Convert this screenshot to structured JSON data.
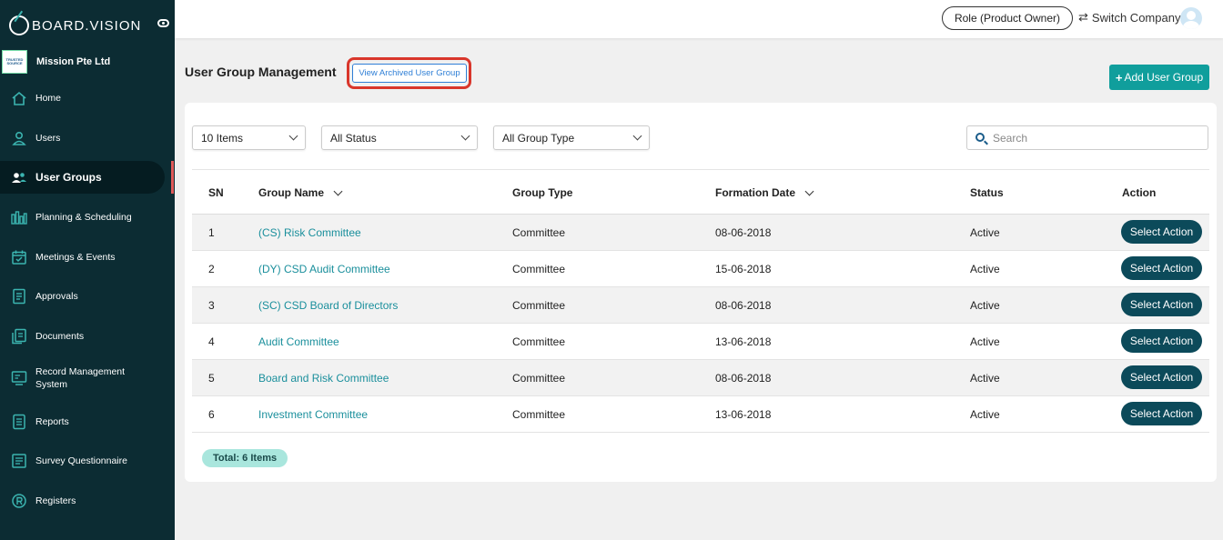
{
  "sidebar": {
    "brand": "BOARD.VISION",
    "company_logo_text": "TRUSTED SOURCE",
    "company": "Mission Pte Ltd",
    "items": [
      {
        "label": "Home",
        "icon": "home-icon"
      },
      {
        "label": "Users",
        "icon": "user-icon"
      },
      {
        "label": "User Groups",
        "icon": "user-group-icon"
      },
      {
        "label": "Planning & Scheduling",
        "icon": "chart-bars-icon"
      },
      {
        "label": "Meetings & Events",
        "icon": "calendar-icon"
      },
      {
        "label": "Approvals",
        "icon": "approval-doc-icon"
      },
      {
        "label": "Documents",
        "icon": "documents-icon"
      },
      {
        "label": "Record Management System",
        "icon": "record-monitor-icon"
      },
      {
        "label": "Reports",
        "icon": "report-icon"
      },
      {
        "label": "Survey Questionnaire",
        "icon": "survey-icon"
      },
      {
        "label": "Registers",
        "icon": "registered-icon"
      }
    ],
    "active_item": "User Groups"
  },
  "topbar": {
    "role": "Role (Product Owner)",
    "switch_company": "Switch Company"
  },
  "header": {
    "title": "User Group Management",
    "archived_link": "View Archived User Group",
    "add_button": "Add User Group"
  },
  "filters": {
    "items": "10 Items",
    "status": "All Status",
    "group_type": "All Group Type",
    "search_placeholder": "Search"
  },
  "table": {
    "columns": [
      "SN",
      "Group Name",
      "Group Type",
      "Formation Date",
      "Status",
      "Action"
    ],
    "rows": [
      {
        "sn": "1",
        "name": "(CS) Risk Committee",
        "type": "Committee",
        "date": "08-06-2018",
        "status": "Active",
        "action": "Select Action"
      },
      {
        "sn": "2",
        "name": "(DY) CSD Audit Committee",
        "type": "Committee",
        "date": "15-06-2018",
        "status": "Active",
        "action": "Select Action"
      },
      {
        "sn": "3",
        "name": "(SC) CSD Board of Directors",
        "type": "Committee",
        "date": "08-06-2018",
        "status": "Active",
        "action": "Select Action"
      },
      {
        "sn": "4",
        "name": "Audit Committee",
        "type": "Committee",
        "date": "13-06-2018",
        "status": "Active",
        "action": "Select Action"
      },
      {
        "sn": "5",
        "name": "Board and Risk Committee",
        "type": "Committee",
        "date": "08-06-2018",
        "status": "Active",
        "action": "Select Action"
      },
      {
        "sn": "6",
        "name": "Investment Committee",
        "type": "Committee",
        "date": "13-06-2018",
        "status": "Active",
        "action": "Select Action"
      }
    ]
  },
  "footer": {
    "total": "Total: 6 Items"
  },
  "colors": {
    "sidebar_bg": "#0c2c33",
    "accent_teal": "#109e9c",
    "link": "#1a8f9c",
    "action_button": "#0c4a5a",
    "highlight_red": "#d9362b"
  }
}
